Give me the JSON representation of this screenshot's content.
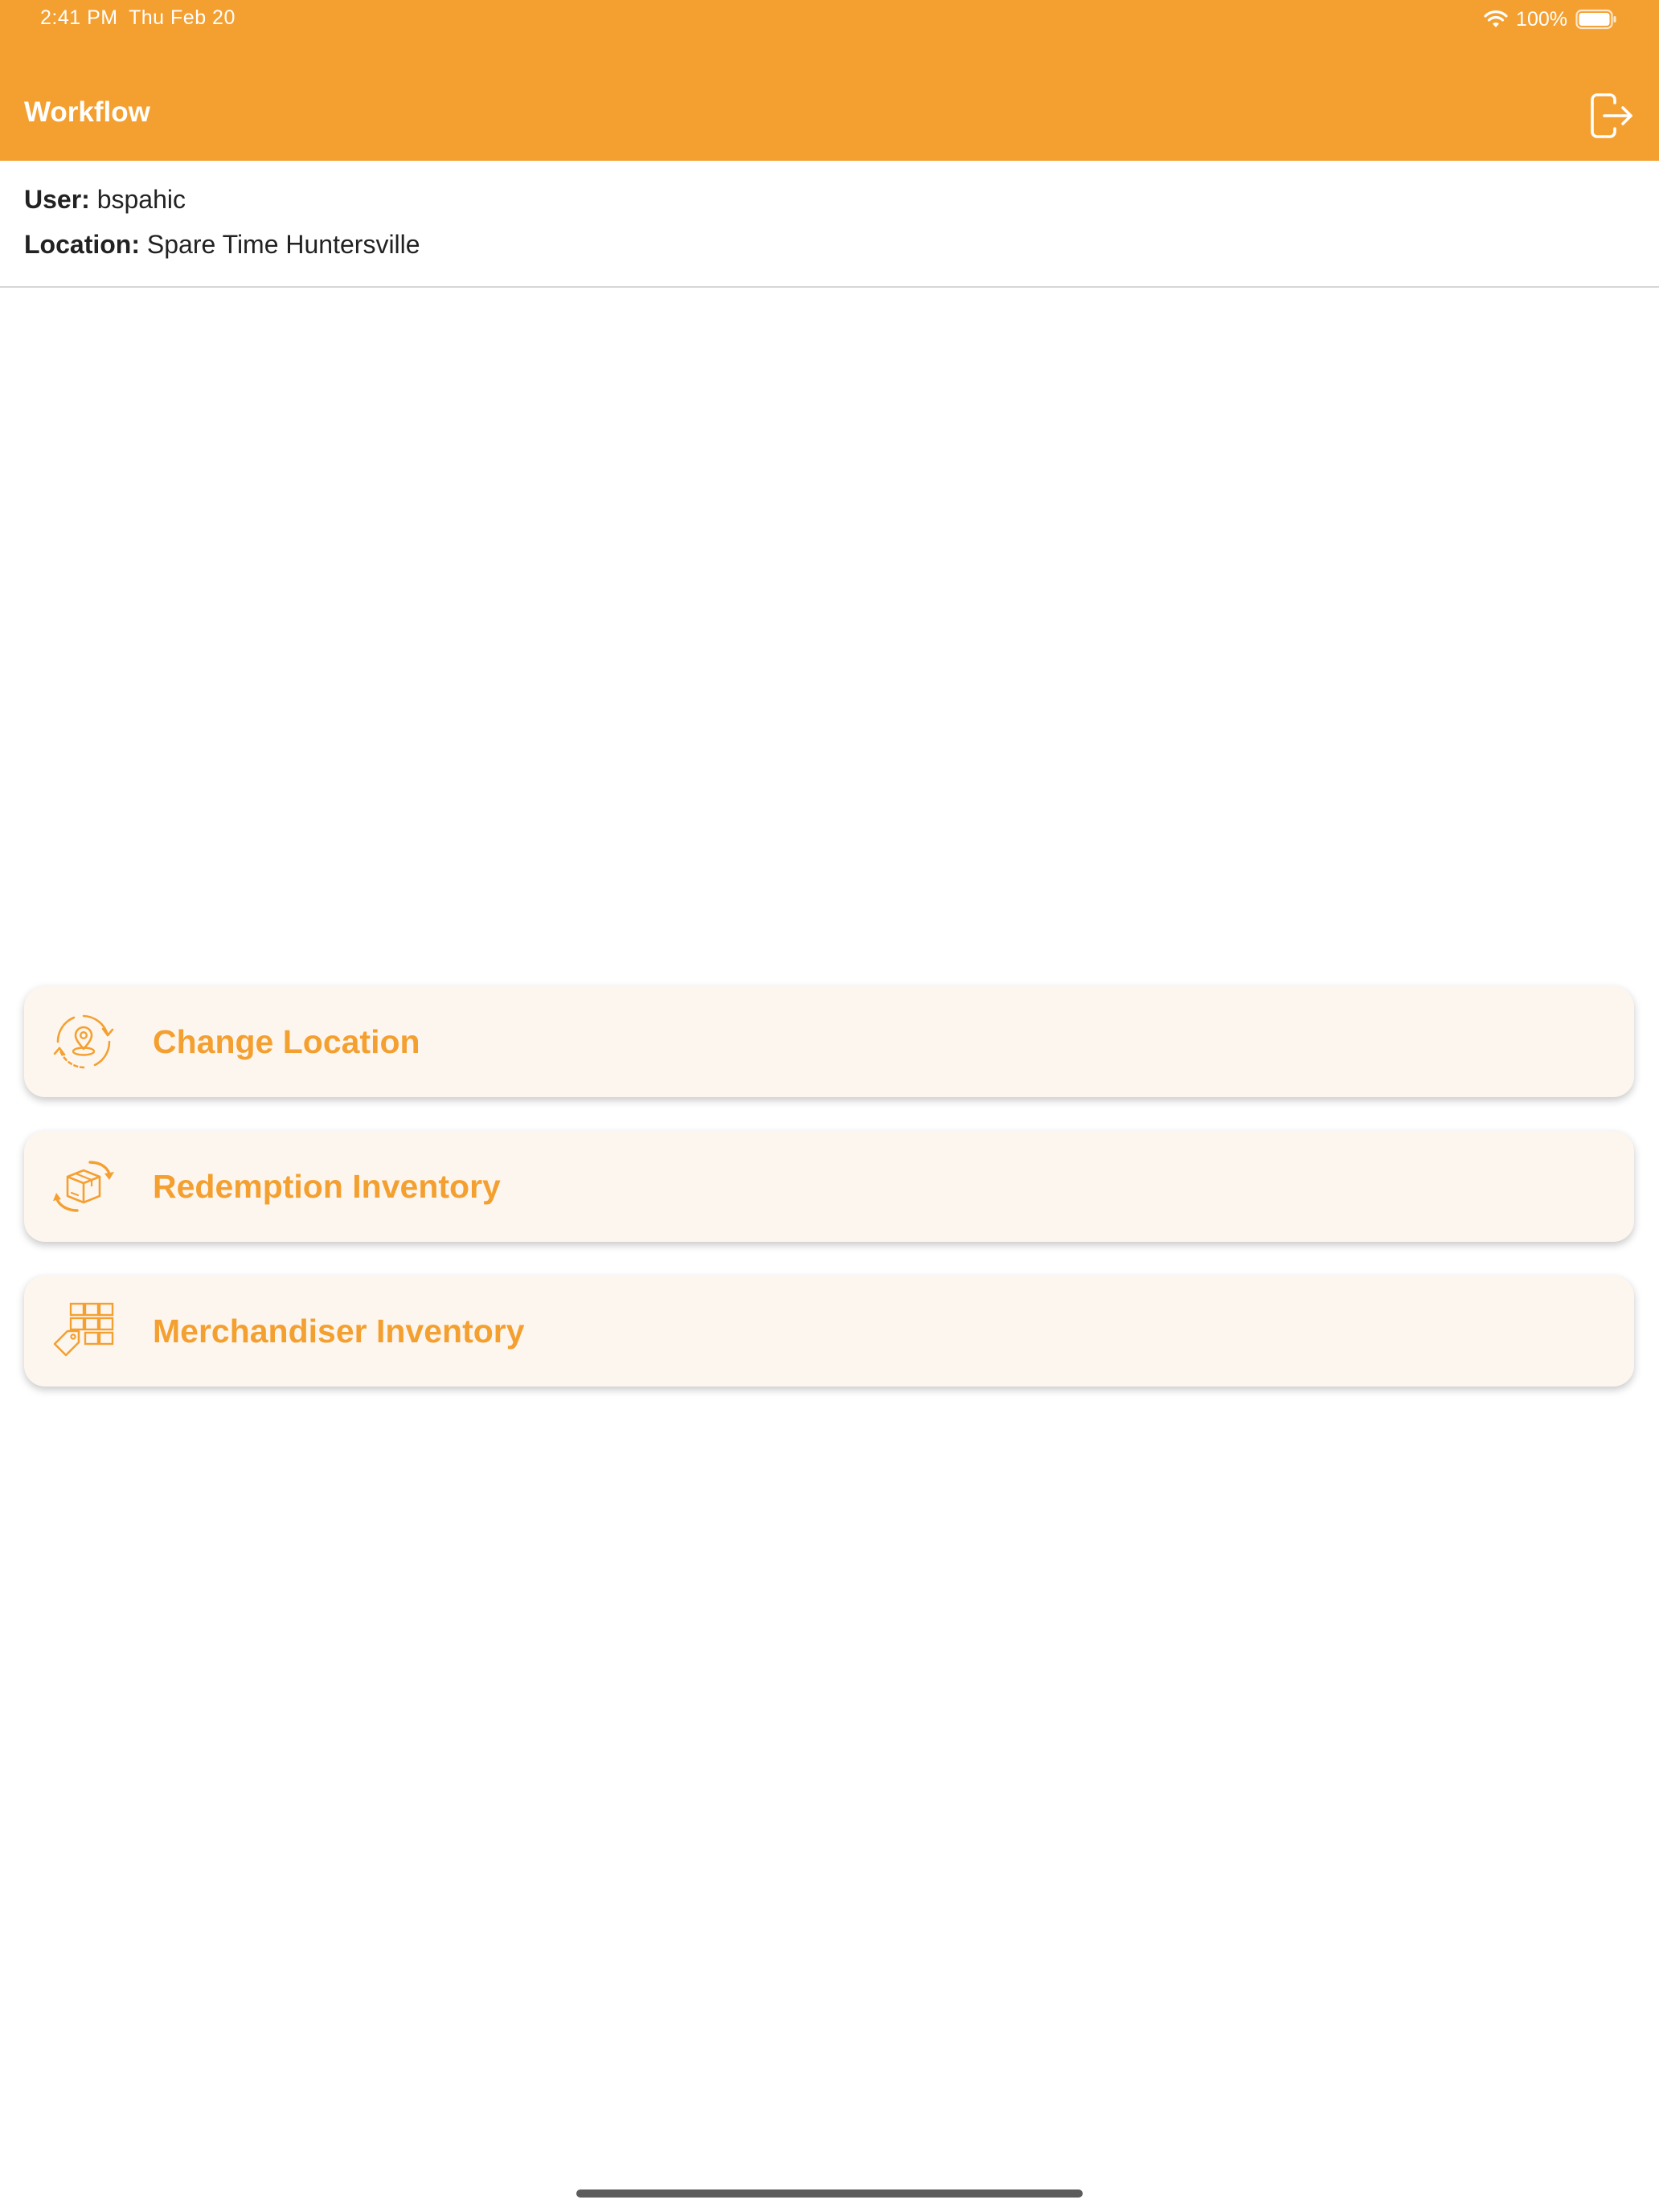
{
  "status_bar": {
    "time": "2:41 PM",
    "date": "Thu Feb 20",
    "battery": "100%"
  },
  "nav": {
    "title": "Workflow",
    "logout_icon": "logout-icon"
  },
  "info": {
    "user_label": "User:",
    "user_value": "bspahic",
    "location_label": "Location:",
    "location_value": "Spare Time Huntersville"
  },
  "menu": [
    {
      "label": "Change Location",
      "icon": "location-refresh-icon"
    },
    {
      "label": "Redemption Inventory",
      "icon": "box-cycle-icon"
    },
    {
      "label": "Merchandiser Inventory",
      "icon": "shelf-tag-icon"
    }
  ],
  "colors": {
    "accent": "#f4a031",
    "card_background": "#fdf6ef"
  }
}
